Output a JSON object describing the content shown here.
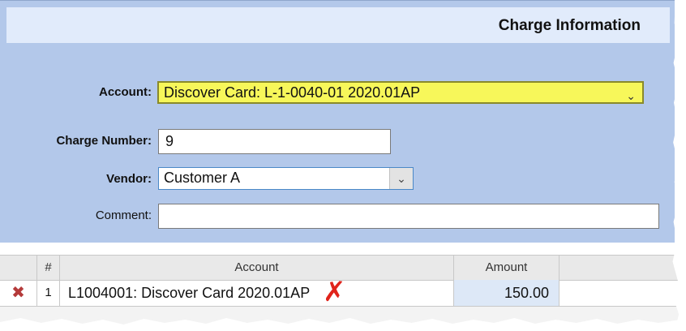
{
  "header": {
    "title": "Charge Information"
  },
  "form": {
    "account_label": "Account:",
    "account_value": "Discover Card: L-1-0040-01 2020.01AP",
    "charge_number_label": "Charge Number:",
    "charge_number_value": "9",
    "vendor_label": "Vendor:",
    "vendor_value": "Customer A",
    "comment_label": "Comment:",
    "comment_value": ""
  },
  "grid": {
    "columns": [
      "#",
      "Account",
      "Amount"
    ],
    "rows": [
      {
        "num": "1",
        "account": "L1004001: Discover Card 2020.01AP",
        "amount": "150.00"
      }
    ]
  },
  "icons": {
    "chevron": "chevron-down-icon",
    "delete": "delete-x-icon",
    "error": "error-x-icon"
  },
  "colors": {
    "panel": "#b3c8ea",
    "highlight": "#f7f75a",
    "error": "#e0231b"
  }
}
